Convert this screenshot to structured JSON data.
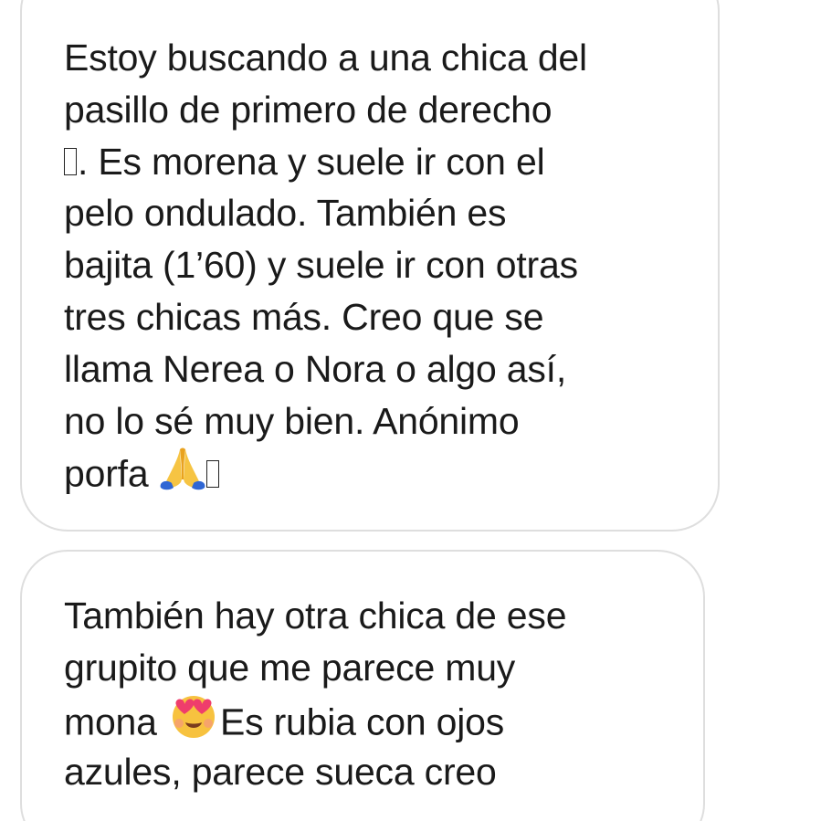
{
  "messages": [
    {
      "lines": [
        "Estoy buscando a una chica del",
        "pasillo de primero de derecho",
        ". Es morena y suele ir con el",
        "pelo ondulado. También es",
        "bajita (1’60) y suele ir con otras",
        "tres chicas más. Creo que se",
        "llama Nerea o Nora o algo así,",
        "no lo sé muy bien. Anónimo",
        "porfa"
      ],
      "emoji": {
        "praying_hands": "praying-hands-icon"
      }
    },
    {
      "lines": [
        "También hay otra chica de ese",
        "grupito que me parece muy",
        "mona",
        "Es rubia con ojos",
        "azules, parece sueca creo"
      ],
      "emoji": {
        "heart_eyes": "heart-eyes-icon"
      }
    }
  ],
  "colors": {
    "bubble_border": "#dedede",
    "text": "#1a1a1a",
    "background": "#ffffff"
  }
}
